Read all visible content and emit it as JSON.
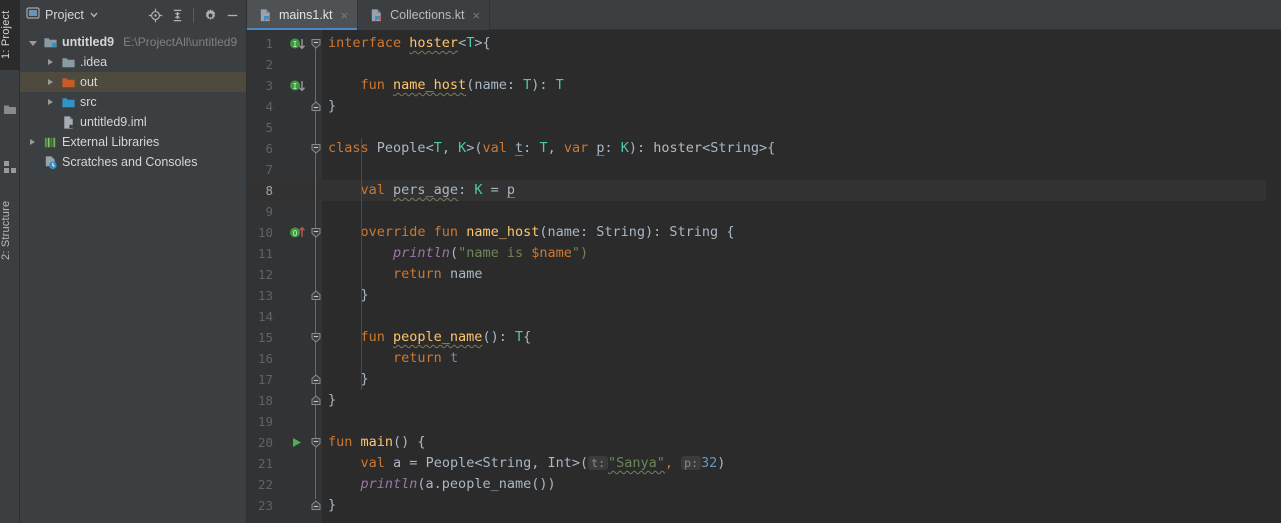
{
  "window": {
    "theme": "Darcula",
    "accent_color": "#4a88c7",
    "editor_bg": "#2b2b2b",
    "panel_bg": "#3c3f41"
  },
  "left_strip": {
    "tabs": [
      {
        "label": "1: Project",
        "active": true
      },
      {
        "label": "2: Structure",
        "active": false
      }
    ]
  },
  "project_panel": {
    "title": "Project",
    "dropdown_icon": "chevron-down-icon",
    "toolbar": [
      {
        "name": "locate-icon",
        "label": "Select Opened File"
      },
      {
        "name": "collapse-all-icon",
        "label": "Collapse All"
      },
      {
        "name": "gear-icon",
        "label": "Settings"
      },
      {
        "name": "minimize-icon",
        "label": "Hide"
      }
    ],
    "tree": [
      {
        "label": "untitled9",
        "path": "E:\\ProjectAll\\untitled9",
        "indent": 0,
        "arrow": "open",
        "icon": "module-icon",
        "bold": true,
        "selected": false
      },
      {
        "label": ".idea",
        "path": "",
        "indent": 1,
        "arrow": "closed",
        "icon": "folder-icon-gray",
        "bold": false,
        "selected": false
      },
      {
        "label": "out",
        "path": "",
        "indent": 1,
        "arrow": "closed",
        "icon": "folder-icon-orange",
        "bold": false,
        "selected": true
      },
      {
        "label": "src",
        "path": "",
        "indent": 1,
        "arrow": "closed",
        "icon": "folder-icon-blue",
        "bold": false,
        "selected": false
      },
      {
        "label": "untitled9.iml",
        "path": "",
        "indent": 1,
        "arrow": "none",
        "icon": "iml-file-icon",
        "bold": false,
        "selected": false
      },
      {
        "label": "External Libraries",
        "path": "",
        "indent": 0,
        "arrow": "closed",
        "icon": "libraries-icon",
        "bold": false,
        "selected": false
      },
      {
        "label": "Scratches and Consoles",
        "path": "",
        "indent": 0,
        "arrow": "none",
        "icon": "scratches-icon",
        "bold": false,
        "selected": false
      }
    ]
  },
  "editor": {
    "tabs": [
      {
        "label": "mains1.kt",
        "icon": "kotlin-file-icon",
        "active": true,
        "close_glyph": "×"
      },
      {
        "label": "Collections.kt",
        "icon": "kotlin-file-icon",
        "active": false,
        "close_glyph": "×"
      }
    ],
    "current_line": 8,
    "line_numbers": [
      1,
      2,
      3,
      4,
      5,
      6,
      7,
      8,
      9,
      10,
      11,
      12,
      13,
      14,
      15,
      16,
      17,
      18,
      19,
      20,
      21,
      22,
      23
    ],
    "gutter_markers": [
      {
        "line": 1,
        "type": "implemented-icon",
        "glyph": "I",
        "arrow": "down"
      },
      {
        "line": 3,
        "type": "implemented-icon",
        "glyph": "I",
        "arrow": "down"
      },
      {
        "line": 10,
        "type": "overrides-icon",
        "glyph": "O",
        "arrow": "up"
      },
      {
        "line": 20,
        "type": "run-icon",
        "glyph": "▶",
        "arrow": "none"
      }
    ],
    "fold_markers": [
      {
        "line": 1,
        "type": "fold-expanded-top"
      },
      {
        "line": 4,
        "type": "fold-expanded-bottom"
      },
      {
        "line": 6,
        "type": "fold-expanded-top"
      },
      {
        "line": 10,
        "type": "fold-expanded-top"
      },
      {
        "line": 13,
        "type": "fold-expanded-bottom"
      },
      {
        "line": 15,
        "type": "fold-expanded-top"
      },
      {
        "line": 17,
        "type": "fold-expanded-bottom"
      },
      {
        "line": 18,
        "type": "fold-expanded-bottom"
      },
      {
        "line": 20,
        "type": "fold-expanded-top"
      },
      {
        "line": 23,
        "type": "fold-expanded-bottom"
      }
    ],
    "source_text": "interface hoster<T>{\n\n    fun name_host(name: T): T\n}\n\nclass People<T, K>(val t: T, var p: K): hoster<String>{\n\n    val pers_age: K = p\n\n    override fun name_host(name: String): String {\n        println(\"name is $name\")\n        return name\n    }\n\n    fun people_name(): T{\n        return t\n    }\n}\n\nfun main() {\n    val a = People<String, Int>(\"Sanya\", 32)\n    println(a.people_name())\n}",
    "parameter_hints": [
      {
        "line": 21,
        "name": "t:"
      },
      {
        "line": 21,
        "name": "p:"
      }
    ],
    "lines": [
      {
        "n": 1,
        "tokens": [
          {
            "t": "interface ",
            "c": "kw"
          },
          {
            "t": "hoster",
            "c": "fn wavyw"
          },
          {
            "t": "<",
            "c": "ident"
          },
          {
            "t": "T",
            "c": "type"
          },
          {
            "t": ">{",
            "c": "ident"
          }
        ]
      },
      {
        "n": 2,
        "tokens": []
      },
      {
        "n": 3,
        "tokens": [
          {
            "t": "    ",
            "c": "ident"
          },
          {
            "t": "fun ",
            "c": "kw"
          },
          {
            "t": "name_host",
            "c": "fn wavyw"
          },
          {
            "t": "(name: ",
            "c": "ident"
          },
          {
            "t": "T",
            "c": "type"
          },
          {
            "t": "): ",
            "c": "ident"
          },
          {
            "t": "T",
            "c": "type"
          }
        ]
      },
      {
        "n": 4,
        "tokens": [
          {
            "t": "}",
            "c": "ident"
          }
        ]
      },
      {
        "n": 5,
        "tokens": []
      },
      {
        "n": 6,
        "tokens": [
          {
            "t": "class ",
            "c": "kw"
          },
          {
            "t": "People",
            "c": "ident"
          },
          {
            "t": "<",
            "c": "ident"
          },
          {
            "t": "T",
            "c": "type"
          },
          {
            "t": ", ",
            "c": "ident"
          },
          {
            "t": "K",
            "c": "type"
          },
          {
            "t": ">(",
            "c": "ident"
          },
          {
            "t": "val ",
            "c": "kw"
          },
          {
            "t": "t",
            "c": "ident uline"
          },
          {
            "t": ": ",
            "c": "ident"
          },
          {
            "t": "T",
            "c": "type"
          },
          {
            "t": ", ",
            "c": "ident"
          },
          {
            "t": "var ",
            "c": "kw"
          },
          {
            "t": "p",
            "c": "ident uline"
          },
          {
            "t": ": ",
            "c": "ident"
          },
          {
            "t": "K",
            "c": "type"
          },
          {
            "t": "): ",
            "c": "ident"
          },
          {
            "t": "hoster",
            "c": "cls"
          },
          {
            "t": "<String>{",
            "c": "ident"
          }
        ]
      },
      {
        "n": 7,
        "tokens": []
      },
      {
        "n": 8,
        "tokens": [
          {
            "t": "    ",
            "c": "ident"
          },
          {
            "t": "val ",
            "c": "kw"
          },
          {
            "t": "pers_age",
            "c": "ident wavyw"
          },
          {
            "t": ": ",
            "c": "ident"
          },
          {
            "t": "K",
            "c": "type"
          },
          {
            "t": " = ",
            "c": "ident"
          },
          {
            "t": "p",
            "c": "ident uline"
          }
        ]
      },
      {
        "n": 9,
        "tokens": []
      },
      {
        "n": 10,
        "tokens": [
          {
            "t": "    ",
            "c": "ident"
          },
          {
            "t": "override fun ",
            "c": "kw"
          },
          {
            "t": "name_host",
            "c": "fn"
          },
          {
            "t": "(name: ",
            "c": "ident"
          },
          {
            "t": "String",
            "c": "ident"
          },
          {
            "t": "): ",
            "c": "ident"
          },
          {
            "t": "String {",
            "c": "ident"
          }
        ]
      },
      {
        "n": 11,
        "tokens": [
          {
            "t": "        ",
            "c": "ident"
          },
          {
            "t": "println",
            "c": "softkw"
          },
          {
            "t": "(",
            "c": "ident"
          },
          {
            "t": "\"name is ",
            "c": "str"
          },
          {
            "t": "$name",
            "c": "gstr"
          },
          {
            "t": "\")",
            "c": "str"
          }
        ]
      },
      {
        "n": 12,
        "tokens": [
          {
            "t": "        ",
            "c": "ident"
          },
          {
            "t": "return ",
            "c": "kw"
          },
          {
            "t": "name",
            "c": "ident"
          }
        ]
      },
      {
        "n": 13,
        "tokens": [
          {
            "t": "    }",
            "c": "ident"
          }
        ]
      },
      {
        "n": 14,
        "tokens": []
      },
      {
        "n": 15,
        "tokens": [
          {
            "t": "    ",
            "c": "ident"
          },
          {
            "t": "fun ",
            "c": "kw"
          },
          {
            "t": "people_name",
            "c": "fn wavyw"
          },
          {
            "t": "(): ",
            "c": "ident"
          },
          {
            "t": "T",
            "c": "type"
          },
          {
            "t": "{",
            "c": "ident"
          }
        ]
      },
      {
        "n": 16,
        "tokens": [
          {
            "t": "        ",
            "c": "ident"
          },
          {
            "t": "return ",
            "c": "kw"
          },
          {
            "t": "t",
            "c": "prop"
          }
        ]
      },
      {
        "n": 17,
        "tokens": [
          {
            "t": "    }",
            "c": "ident"
          }
        ]
      },
      {
        "n": 18,
        "tokens": [
          {
            "t": "}",
            "c": "ident"
          }
        ]
      },
      {
        "n": 19,
        "tokens": []
      },
      {
        "n": 20,
        "tokens": [
          {
            "t": "fun ",
            "c": "kw"
          },
          {
            "t": "main",
            "c": "fn"
          },
          {
            "t": "() {",
            "c": "ident"
          }
        ]
      },
      {
        "n": 21,
        "tokens": [
          {
            "t": "    ",
            "c": "ident"
          },
          {
            "t": "val ",
            "c": "kw"
          },
          {
            "t": "a",
            "c": "ident"
          },
          {
            "t": " = ",
            "c": "ident"
          },
          {
            "t": "People",
            "c": "ident"
          },
          {
            "t": "<String, Int>(",
            "c": "ident"
          },
          {
            "t": "HINT:t:",
            "c": "paramhint"
          },
          {
            "t": "\"Sanya\"",
            "c": "str wavy"
          },
          {
            "t": ", ",
            "c": "gstr"
          },
          {
            "t": "HINT:p:",
            "c": "paramhint"
          },
          {
            "t": "32",
            "c": "num"
          },
          {
            "t": ")",
            "c": "ident"
          }
        ]
      },
      {
        "n": 22,
        "tokens": [
          {
            "t": "    ",
            "c": "ident"
          },
          {
            "t": "println",
            "c": "softkw"
          },
          {
            "t": "(a.people_name())",
            "c": "ident"
          }
        ]
      },
      {
        "n": 23,
        "tokens": [
          {
            "t": "}",
            "c": "ident"
          }
        ]
      }
    ]
  }
}
